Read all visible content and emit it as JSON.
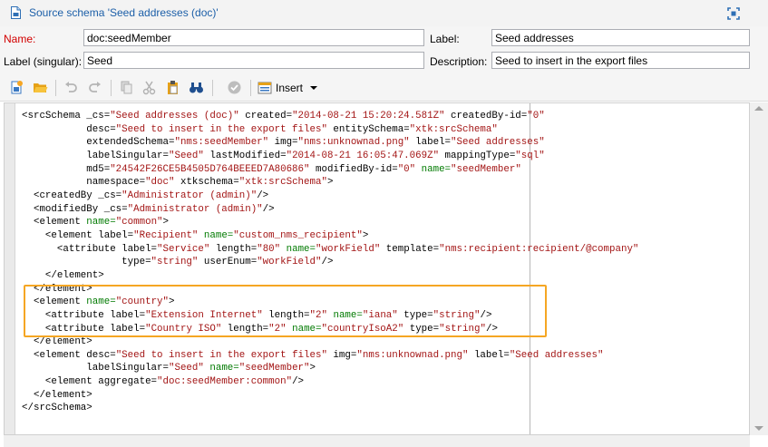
{
  "window": {
    "title": "Source schema 'Seed addresses (doc)'"
  },
  "form": {
    "name_label": "Name:",
    "name_value": "doc:seedMember",
    "label_label": "Label:",
    "label_value": "Seed addresses",
    "singular_label": "Label (singular):",
    "singular_value": "Seed",
    "description_label": "Description:",
    "description_value": "Seed to insert in the export files"
  },
  "toolbar": {
    "insert_label": "Insert",
    "icons": [
      "new-icon",
      "open-folder-icon",
      "undo-icon",
      "redo-icon",
      "copy-icon",
      "cut-icon",
      "paste-icon",
      "binoculars-icon",
      "check-icon",
      "insert-icon"
    ]
  },
  "colors": {
    "required_label": "#d20000",
    "title_text": "#1c5fa8",
    "xml_value": "#a31515",
    "xml_attr_name": "#007a00",
    "highlight_border": "#f5a623"
  },
  "editor": {
    "lines": [
      [
        [
          "t",
          "<srcSchema "
        ],
        [
          "a",
          "_cs="
        ],
        [
          "v",
          "\"Seed addresses (doc)\""
        ],
        [
          "a",
          " created="
        ],
        [
          "v",
          "\"2014-08-21 15:20:24.581Z\""
        ],
        [
          "a",
          " createdBy-id="
        ],
        [
          "v",
          "\"0\""
        ]
      ],
      [
        [
          "a",
          "           desc="
        ],
        [
          "v",
          "\"Seed to insert in the export files\""
        ],
        [
          "a",
          " entitySchema="
        ],
        [
          "v",
          "\"xtk:srcSchema\""
        ]
      ],
      [
        [
          "a",
          "           extendedSchema="
        ],
        [
          "v",
          "\"nms:seedMember\""
        ],
        [
          "a",
          " img="
        ],
        [
          "v",
          "\"nms:unknownad.png\""
        ],
        [
          "a",
          " label="
        ],
        [
          "v",
          "\"Seed addresses\""
        ]
      ],
      [
        [
          "a",
          "           labelSingular="
        ],
        [
          "v",
          "\"Seed\""
        ],
        [
          "a",
          " lastModified="
        ],
        [
          "v",
          "\"2014-08-21 16:05:47.069Z\""
        ],
        [
          "a",
          " mappingType="
        ],
        [
          "v",
          "\"sql\""
        ]
      ],
      [
        [
          "a",
          "           md5="
        ],
        [
          "v",
          "\"24542F26CE5B4505D764BEEED7A80686\""
        ],
        [
          "a",
          " modifiedBy-id="
        ],
        [
          "v",
          "\"0\""
        ],
        [
          "an",
          " name="
        ],
        [
          "v",
          "\"seedMember\""
        ]
      ],
      [
        [
          "a",
          "           namespace="
        ],
        [
          "v",
          "\"doc\""
        ],
        [
          "a",
          " xtkschema="
        ],
        [
          "v",
          "\"xtk:srcSchema\""
        ],
        [
          "t",
          ">"
        ]
      ],
      [
        [
          "t",
          "  <createdBy "
        ],
        [
          "a",
          "_cs="
        ],
        [
          "v",
          "\"Administrator (admin)\""
        ],
        [
          "t",
          "/>"
        ]
      ],
      [
        [
          "t",
          "  <modifiedBy "
        ],
        [
          "a",
          "_cs="
        ],
        [
          "v",
          "\"Administrator (admin)\""
        ],
        [
          "t",
          "/>"
        ]
      ],
      [
        [
          "t",
          "  <element "
        ],
        [
          "an",
          "name="
        ],
        [
          "v",
          "\"common\""
        ],
        [
          "t",
          ">"
        ]
      ],
      [
        [
          "t",
          "    <element "
        ],
        [
          "a",
          "label="
        ],
        [
          "v",
          "\"Recipient\""
        ],
        [
          "an",
          " name="
        ],
        [
          "v",
          "\"custom_nms_recipient\""
        ],
        [
          "t",
          ">"
        ]
      ],
      [
        [
          "t",
          "      <attribute "
        ],
        [
          "a",
          "label="
        ],
        [
          "v",
          "\"Service\""
        ],
        [
          "a",
          " length="
        ],
        [
          "v",
          "\"80\""
        ],
        [
          "an",
          " name="
        ],
        [
          "v",
          "\"workField\""
        ],
        [
          "a",
          " template="
        ],
        [
          "v",
          "\"nms:recipient:recipient/@company\""
        ]
      ],
      [
        [
          "a",
          "                 type="
        ],
        [
          "v",
          "\"string\""
        ],
        [
          "a",
          " userEnum="
        ],
        [
          "v",
          "\"workField\""
        ],
        [
          "t",
          "/>"
        ]
      ],
      [
        [
          "t",
          "    </element>"
        ]
      ],
      [
        [
          "t",
          "  </element>"
        ]
      ],
      [
        [
          "t",
          "  <element "
        ],
        [
          "an",
          "name="
        ],
        [
          "v",
          "\"country\""
        ],
        [
          "t",
          ">"
        ]
      ],
      [
        [
          "t",
          "    <attribute "
        ],
        [
          "a",
          "label="
        ],
        [
          "v",
          "\"Extension Internet\""
        ],
        [
          "a",
          " length="
        ],
        [
          "v",
          "\"2\""
        ],
        [
          "an",
          " name="
        ],
        [
          "v",
          "\"iana\""
        ],
        [
          "a",
          " type="
        ],
        [
          "v",
          "\"string\""
        ],
        [
          "t",
          "/>"
        ]
      ],
      [
        [
          "t",
          "    <attribute "
        ],
        [
          "a",
          "label="
        ],
        [
          "v",
          "\"Country ISO\""
        ],
        [
          "a",
          " length="
        ],
        [
          "v",
          "\"2\""
        ],
        [
          "an",
          " name="
        ],
        [
          "v",
          "\"countryIsoA2\""
        ],
        [
          "a",
          " type="
        ],
        [
          "v",
          "\"string\""
        ],
        [
          "t",
          "/>"
        ]
      ],
      [
        [
          "t",
          "  </element>"
        ]
      ],
      [
        [
          "t",
          "  <element "
        ],
        [
          "a",
          "desc="
        ],
        [
          "v",
          "\"Seed to insert in the export files\""
        ],
        [
          "a",
          " img="
        ],
        [
          "v",
          "\"nms:unknownad.png\""
        ],
        [
          "a",
          " label="
        ],
        [
          "v",
          "\"Seed addresses\""
        ]
      ],
      [
        [
          "a",
          "           labelSingular="
        ],
        [
          "v",
          "\"Seed\""
        ],
        [
          "an",
          " name="
        ],
        [
          "v",
          "\"seedMember\""
        ],
        [
          "t",
          ">"
        ]
      ],
      [
        [
          "t",
          "    <element "
        ],
        [
          "a",
          "aggregate="
        ],
        [
          "v",
          "\"doc:seedMember:common\""
        ],
        [
          "t",
          "/>"
        ]
      ],
      [
        [
          "t",
          "  </element>"
        ]
      ],
      [
        [
          "t",
          "</srcSchema>"
        ]
      ]
    ]
  }
}
